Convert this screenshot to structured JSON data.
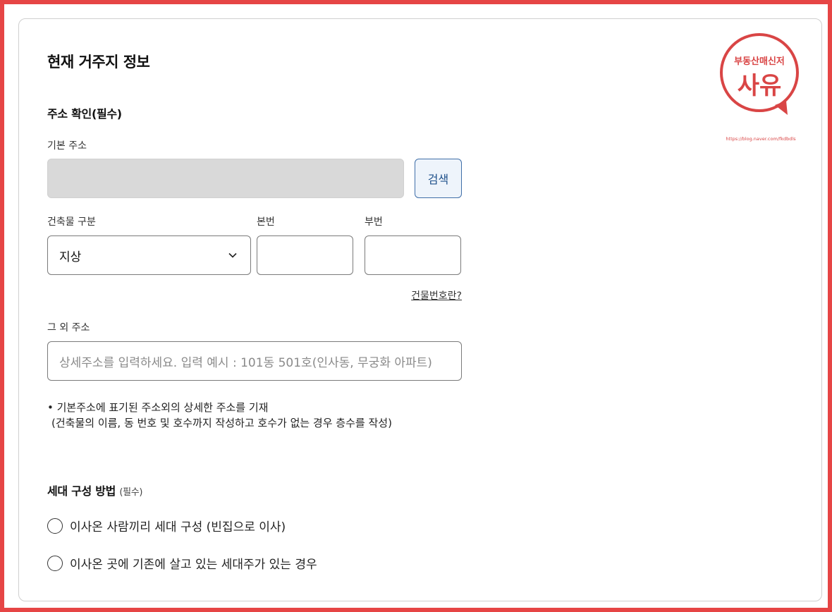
{
  "page": {
    "title": "현재 거주지 정보"
  },
  "address_section": {
    "title": "주소 확인(필수)",
    "base_address_label": "기본 주소",
    "base_address_value": "",
    "search_button": "검색",
    "building_type_label": "건축물 구분",
    "building_type_value": "지상",
    "main_no_label": "본번",
    "sub_no_label": "부번",
    "building_no_link": "건물번호란?",
    "other_address_label": "그 외 주소",
    "other_address_placeholder": "상세주소를 입력하세요. 입력 예시 : 101동 501호(인사동, 무궁화 아파트)",
    "note_line1": "• 기본주소에 표기된 주소외의 상세한 주소를 기재",
    "note_line2": "(건축물의 이름, 동 번호 및 호수까지 작성하고 호수가 없는 경우 층수를 작성)"
  },
  "household_section": {
    "title": "세대 구성 방법",
    "required": "(필수)",
    "options": [
      "이사온 사람끼리 세대 구성 (빈집으로 이사)",
      "이사온 곳에 기존에 살고 있는 세대주가 있는 경우"
    ]
  },
  "logo": {
    "top_text": "부동산매신저",
    "main_text": "사유",
    "url_text": "https://blog.naver.com/fkdbdls",
    "color": "#d94545"
  },
  "colors": {
    "frame": "#e64545",
    "accent": "#3f6ea8"
  }
}
